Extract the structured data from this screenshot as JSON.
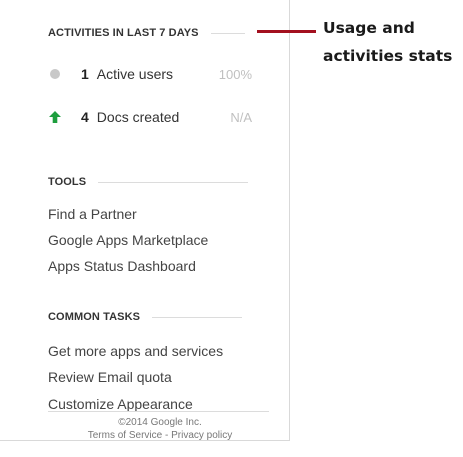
{
  "activities": {
    "title": "ACTIVITIES IN LAST 7 DAYS",
    "stats": [
      {
        "icon": "status-dot-icon",
        "count": "1",
        "label": "Active users",
        "pct": "100%"
      },
      {
        "icon": "green-up-arrow-icon",
        "count": "4",
        "label": "Docs created",
        "pct": "N/A"
      }
    ]
  },
  "tools": {
    "title": "TOOLS",
    "links": [
      "Find a Partner",
      "Google Apps Marketplace",
      "Apps Status Dashboard"
    ]
  },
  "common_tasks": {
    "title": "COMMON TASKS",
    "links": [
      "Get more apps and services",
      "Review Email quota",
      "Customize Appearance"
    ]
  },
  "footer": {
    "copyright": "©2014 Google Inc.",
    "terms": "Terms of Service",
    "separator": "-",
    "privacy": "Privacy policy"
  },
  "callout": {
    "line1": "Usage and",
    "line2": "activities stats",
    "color": "#a3101f"
  },
  "colors": {
    "arrow_green": "#1e9e3e",
    "dot_gray": "#c8c8c8"
  }
}
